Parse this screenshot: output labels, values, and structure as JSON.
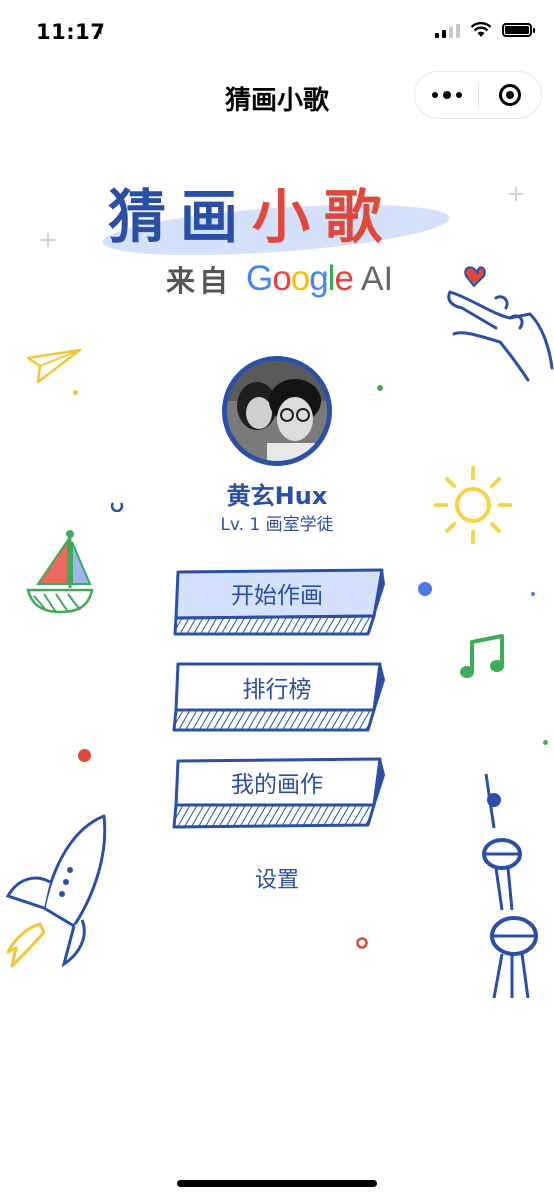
{
  "status_bar": {
    "time": "11:17",
    "location_icon": "location-arrow-icon",
    "icons": [
      "signal-icon",
      "wifi-icon",
      "battery-icon"
    ]
  },
  "nav": {
    "title": "猜画小歌",
    "more_icon": "more-dots-icon",
    "close_icon": "close-circle-icon"
  },
  "logo": {
    "title_parts": [
      {
        "text": "猜",
        "color": "#2a4fa7"
      },
      {
        "text": "画",
        "color": "#2a4fa7"
      },
      {
        "text": "小",
        "color": "#e0483b"
      },
      {
        "text": "歌",
        "color": "#e0483b"
      }
    ],
    "from_label": "来自",
    "brand": "Google",
    "brand_colors": [
      "#4285f4",
      "#ea4335",
      "#fbbc05",
      "#4285f4",
      "#34a853",
      "#ea4335"
    ],
    "suffix": "AI"
  },
  "user": {
    "name": "黄玄Hux",
    "level": "Lv. 1 画室学徒"
  },
  "menu": [
    {
      "label": "开始作画",
      "highlighted": true
    },
    {
      "label": "排行榜",
      "highlighted": false
    },
    {
      "label": "我的画作",
      "highlighted": false
    }
  ],
  "settings_label": "设置",
  "colors": {
    "primary": "#2a4fa7",
    "highlight_fill": "#d5e1fb",
    "accent_red": "#e0483b",
    "yellow": "#f5d34a",
    "green": "#3dab5a"
  }
}
